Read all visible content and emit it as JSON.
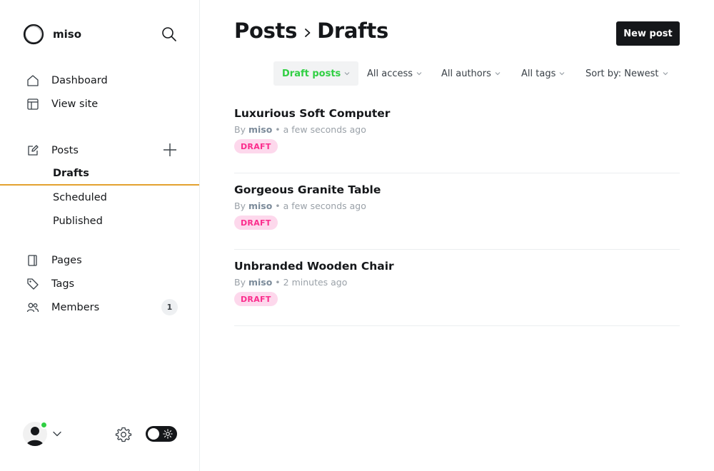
{
  "brand": {
    "name": "miso"
  },
  "sidebar": {
    "nav": [
      {
        "label": "Dashboard",
        "icon": "home-icon"
      },
      {
        "label": "View site",
        "icon": "window-icon"
      }
    ],
    "posts": {
      "label": "Posts",
      "icon": "edit-icon",
      "sub": [
        {
          "label": "Drafts",
          "active": true
        },
        {
          "label": "Scheduled",
          "active": false
        },
        {
          "label": "Published",
          "active": false
        }
      ]
    },
    "secondary": [
      {
        "label": "Pages",
        "icon": "page-icon"
      },
      {
        "label": "Tags",
        "icon": "tag-icon"
      },
      {
        "label": "Members",
        "icon": "members-icon",
        "badge": "1"
      }
    ]
  },
  "header": {
    "title_section": "Posts",
    "title_page": "Drafts",
    "new_post_label": "New post"
  },
  "filters": [
    {
      "label": "Draft posts",
      "active": true
    },
    {
      "label": "All access",
      "active": false
    },
    {
      "label": "All authors",
      "active": false
    },
    {
      "label": "All tags",
      "active": false
    },
    {
      "label": "Sort by: Newest",
      "active": false
    }
  ],
  "posts": [
    {
      "title": "Luxurious Soft Computer",
      "by": "By",
      "author": "miso",
      "time": "• a few seconds ago",
      "status": "DRAFT"
    },
    {
      "title": "Gorgeous Granite Table",
      "by": "By",
      "author": "miso",
      "time": "• a few seconds ago",
      "status": "DRAFT"
    },
    {
      "title": "Unbranded Wooden Chair",
      "by": "By",
      "author": "miso",
      "time": "• 2 minutes ago",
      "status": "DRAFT"
    }
  ],
  "colors": {
    "accent_green": "#30cf43",
    "draft_pink": "#fb2d8d",
    "draft_pink_bg": "#fdd8ec",
    "active_underline": "#e3a12f",
    "dark": "#15171a"
  }
}
